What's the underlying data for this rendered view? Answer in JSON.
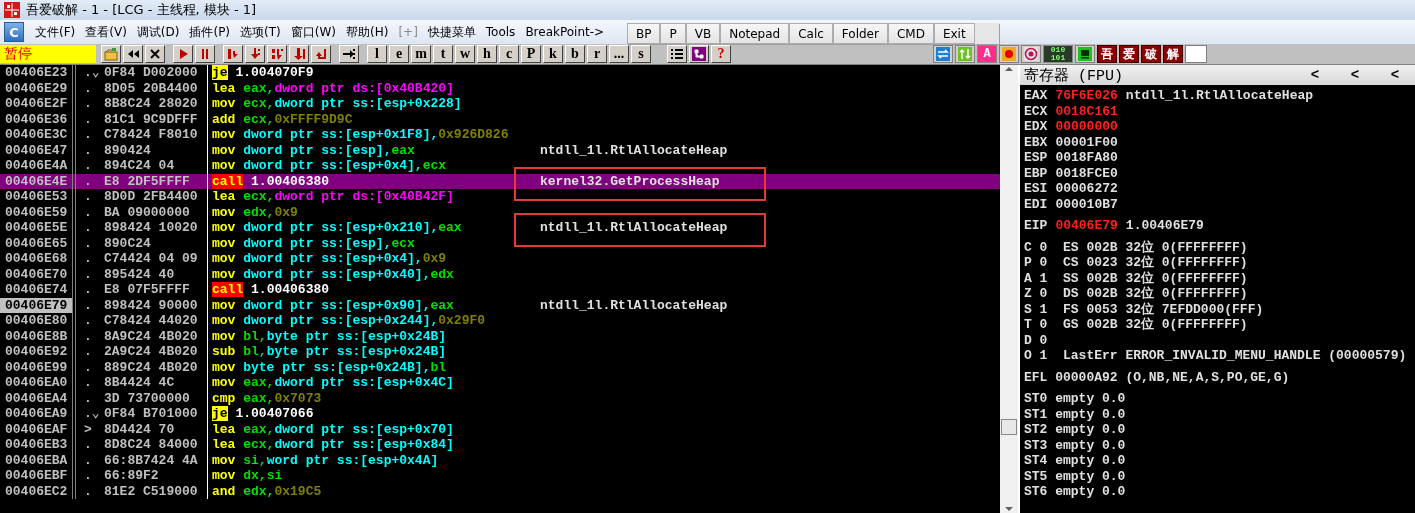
{
  "window": {
    "title": "吾爱破解 - 1 - [LCG - 主线程, 模块 - 1]"
  },
  "menu": {
    "app_label": "C",
    "items": [
      {
        "label": "文件(F)",
        "disabled": false
      },
      {
        "label": "查看(V)",
        "disabled": false
      },
      {
        "label": "调试(D)",
        "disabled": false
      },
      {
        "label": "插件(P)",
        "disabled": false
      },
      {
        "label": "选项(T)",
        "disabled": false
      },
      {
        "label": "窗口(W)",
        "disabled": false
      },
      {
        "label": "帮助(H)",
        "disabled": false
      },
      {
        "label": "[+]",
        "disabled": true
      },
      {
        "label": "快捷菜单",
        "disabled": false
      },
      {
        "label": "Tools",
        "disabled": false
      },
      {
        "label": "BreakPoint->",
        "disabled": false
      }
    ]
  },
  "quick_bar": [
    "BP",
    "P",
    "VB",
    "Notepad",
    "Calc",
    "Folder",
    "CMD",
    "Exit"
  ],
  "toolbar": {
    "status": "暂停",
    "letters": [
      "l",
      "e",
      "m",
      "t",
      "w",
      "h",
      "c",
      "P",
      "k",
      "b",
      "r",
      "...",
      "s"
    ],
    "help": "?",
    "tools": [
      {
        "kind": "swap"
      },
      {
        "kind": "updown"
      },
      {
        "kind": "letter",
        "label": "A"
      },
      {
        "kind": "record"
      },
      {
        "kind": "target"
      },
      {
        "kind": "binary",
        "label": "010 101"
      },
      {
        "kind": "panel"
      },
      {
        "kind": "char",
        "label": "吾"
      },
      {
        "kind": "char",
        "label": "爱"
      },
      {
        "kind": "char",
        "label": "破"
      },
      {
        "kind": "char",
        "label": "解"
      },
      {
        "kind": "blank"
      }
    ]
  },
  "disassembly": {
    "rows": [
      {
        "address": "00406E23",
        "marker": ".⌄",
        "hex": "0F84 D002000",
        "mnemonic": "je",
        "kind": "jump",
        "operands": [
          {
            "text": "1.004070F9",
            "kind": "addr"
          }
        ],
        "selected": false,
        "eip": false
      },
      {
        "address": "00406E29",
        "marker": ".",
        "hex": "8D05 20B4400",
        "mnemonic": "lea",
        "kind": "plain",
        "operands": [
          {
            "text": "eax,",
            "kind": "reg"
          },
          {
            "text": "dword ptr ds:[0x40B420]",
            "kind": "ds"
          }
        ],
        "selected": false,
        "eip": false
      },
      {
        "address": "00406E2F",
        "marker": ".",
        "hex": "8B8C24 28020",
        "mnemonic": "mov",
        "kind": "plain",
        "operands": [
          {
            "text": "ecx,",
            "kind": "reg"
          },
          {
            "text": "dword ptr ss:[esp+0x228]",
            "kind": "mem"
          }
        ],
        "selected": false,
        "eip": false
      },
      {
        "address": "00406E36",
        "marker": ".",
        "hex": "81C1 9C9DFFF",
        "mnemonic": "add",
        "kind": "plain",
        "operands": [
          {
            "text": "ecx,",
            "kind": "reg"
          },
          {
            "text": "0xFFFF9D9C",
            "kind": "imm"
          }
        ],
        "selected": false,
        "eip": false
      },
      {
        "address": "00406E3C",
        "marker": ".",
        "hex": "C78424 F8010",
        "mnemonic": "mov",
        "kind": "plain",
        "operands": [
          {
            "text": "dword ptr ss:[esp+0x1F8],",
            "kind": "mem"
          },
          {
            "text": "0x926D826",
            "kind": "imm"
          }
        ],
        "selected": false,
        "eip": false
      },
      {
        "address": "00406E47",
        "marker": ".",
        "hex": "890424",
        "mnemonic": "mov",
        "kind": "plain",
        "operands": [
          {
            "text": "dword ptr ss:[esp],",
            "kind": "mem"
          },
          {
            "text": "eax",
            "kind": "reg"
          }
        ],
        "selected": false,
        "eip": false,
        "comment": {
          "text": "ntdll_1l.RtlAllocateHeap",
          "boxed": false
        }
      },
      {
        "address": "00406E4A",
        "marker": ".",
        "hex": "894C24 04",
        "mnemonic": "mov",
        "kind": "plain",
        "operands": [
          {
            "text": "dword ptr ss:[esp+0x4],",
            "kind": "mem"
          },
          {
            "text": "ecx",
            "kind": "reg"
          }
        ],
        "selected": false,
        "eip": false
      },
      {
        "address": "00406E4E",
        "marker": ".",
        "hex": "E8 2DF5FFFF",
        "mnemonic": "call",
        "kind": "call",
        "operands": [
          {
            "text": "1.00406380",
            "kind": "addr"
          }
        ],
        "selected": true,
        "eip": false,
        "comment": {
          "text": "kernel32.GetProcessHeap",
          "boxed": true
        }
      },
      {
        "address": "00406E53",
        "marker": ".",
        "hex": "8D0D 2FB4400",
        "mnemonic": "lea",
        "kind": "plain",
        "operands": [
          {
            "text": "ecx,",
            "kind": "reg"
          },
          {
            "text": "dword ptr ds:[0x40B42F]",
            "kind": "ds"
          }
        ],
        "selected": false,
        "eip": false
      },
      {
        "address": "00406E59",
        "marker": ".",
        "hex": "BA 09000000",
        "mnemonic": "mov",
        "kind": "plain",
        "operands": [
          {
            "text": "edx,",
            "kind": "reg"
          },
          {
            "text": "0x9",
            "kind": "imm"
          }
        ],
        "selected": false,
        "eip": false
      },
      {
        "address": "00406E5E",
        "marker": ".",
        "hex": "898424 10020",
        "mnemonic": "mov",
        "kind": "plain",
        "operands": [
          {
            "text": "dword ptr ss:[esp+0x210],",
            "kind": "mem"
          },
          {
            "text": "eax",
            "kind": "reg"
          }
        ],
        "selected": false,
        "eip": false,
        "comment": {
          "text": "ntdll_1l.RtlAllocateHeap",
          "boxed": true
        }
      },
      {
        "address": "00406E65",
        "marker": ".",
        "hex": "890C24",
        "mnemonic": "mov",
        "kind": "plain",
        "operands": [
          {
            "text": "dword ptr ss:[esp],",
            "kind": "mem"
          },
          {
            "text": "ecx",
            "kind": "reg"
          }
        ],
        "selected": false,
        "eip": false
      },
      {
        "address": "00406E68",
        "marker": ".",
        "hex": "C74424 04 09",
        "mnemonic": "mov",
        "kind": "plain",
        "operands": [
          {
            "text": "dword ptr ss:[esp+0x4],",
            "kind": "mem"
          },
          {
            "text": "0x9",
            "kind": "imm"
          }
        ],
        "selected": false,
        "eip": false
      },
      {
        "address": "00406E70",
        "marker": ".",
        "hex": "895424 40",
        "mnemonic": "mov",
        "kind": "plain",
        "operands": [
          {
            "text": "dword ptr ss:[esp+0x40],",
            "kind": "mem"
          },
          {
            "text": "edx",
            "kind": "reg"
          }
        ],
        "selected": false,
        "eip": false
      },
      {
        "address": "00406E74",
        "marker": ".",
        "hex": "E8 07F5FFFF",
        "mnemonic": "call",
        "kind": "call",
        "operands": [
          {
            "text": "1.00406380",
            "kind": "addr"
          }
        ],
        "selected": false,
        "eip": false
      },
      {
        "address": "00406E79",
        "marker": ".",
        "hex": "898424 90000",
        "mnemonic": "mov",
        "kind": "plain",
        "operands": [
          {
            "text": "dword ptr ss:[esp+0x90],",
            "kind": "mem"
          },
          {
            "text": "eax",
            "kind": "reg"
          }
        ],
        "selected": false,
        "eip": true,
        "comment": {
          "text": "ntdll_1l.RtlAllocateHeap",
          "boxed": false
        }
      },
      {
        "address": "00406E80",
        "marker": ".",
        "hex": "C78424 44020",
        "mnemonic": "mov",
        "kind": "plain",
        "operands": [
          {
            "text": "dword ptr ss:[esp+0x244],",
            "kind": "mem"
          },
          {
            "text": "0x29F0",
            "kind": "imm"
          }
        ],
        "selected": false,
        "eip": false
      },
      {
        "address": "00406E8B",
        "marker": ".",
        "hex": "8A9C24 4B020",
        "mnemonic": "mov",
        "kind": "plain",
        "operands": [
          {
            "text": "bl,",
            "kind": "reg"
          },
          {
            "text": "byte ptr ss:[esp+0x24B]",
            "kind": "mem"
          }
        ],
        "selected": false,
        "eip": false
      },
      {
        "address": "00406E92",
        "marker": ".",
        "hex": "2A9C24 4B020",
        "mnemonic": "sub",
        "kind": "plain",
        "operands": [
          {
            "text": "bl,",
            "kind": "reg"
          },
          {
            "text": "byte ptr ss:[esp+0x24B]",
            "kind": "mem"
          }
        ],
        "selected": false,
        "eip": false
      },
      {
        "address": "00406E99",
        "marker": ".",
        "hex": "889C24 4B020",
        "mnemonic": "mov",
        "kind": "plain",
        "operands": [
          {
            "text": "byte ptr ss:[esp+0x24B],",
            "kind": "mem"
          },
          {
            "text": "bl",
            "kind": "reg"
          }
        ],
        "selected": false,
        "eip": false
      },
      {
        "address": "00406EA0",
        "marker": ".",
        "hex": "8B4424 4C",
        "mnemonic": "mov",
        "kind": "plain",
        "operands": [
          {
            "text": "eax,",
            "kind": "reg"
          },
          {
            "text": "dword ptr ss:[esp+0x4C]",
            "kind": "mem"
          }
        ],
        "selected": false,
        "eip": false
      },
      {
        "address": "00406EA4",
        "marker": ".",
        "hex": "3D 73700000",
        "mnemonic": "cmp",
        "kind": "plain",
        "operands": [
          {
            "text": "eax,",
            "kind": "reg"
          },
          {
            "text": "0x7073",
            "kind": "imm"
          }
        ],
        "selected": false,
        "eip": false
      },
      {
        "address": "00406EA9",
        "marker": ".⌄",
        "hex": "0F84 B701000",
        "mnemonic": "je",
        "kind": "jump",
        "operands": [
          {
            "text": "1.00407066",
            "kind": "addr"
          }
        ],
        "selected": false,
        "eip": false
      },
      {
        "address": "00406EAF",
        "marker": ">",
        "hex": "8D4424 70",
        "mnemonic": "lea",
        "kind": "plain",
        "operands": [
          {
            "text": "eax,",
            "kind": "reg"
          },
          {
            "text": "dword ptr ss:[esp+0x70]",
            "kind": "mem"
          }
        ],
        "selected": false,
        "eip": false
      },
      {
        "address": "00406EB3",
        "marker": ".",
        "hex": "8D8C24 84000",
        "mnemonic": "lea",
        "kind": "plain",
        "operands": [
          {
            "text": "ecx,",
            "kind": "reg"
          },
          {
            "text": "dword ptr ss:[esp+0x84]",
            "kind": "mem"
          }
        ],
        "selected": false,
        "eip": false
      },
      {
        "address": "00406EBA",
        "marker": ".",
        "hex": "66:8B7424 4A",
        "mnemonic": "mov",
        "kind": "plain",
        "operands": [
          {
            "text": "si,",
            "kind": "reg"
          },
          {
            "text": "word ptr ss:[esp+0x4A]",
            "kind": "mem"
          }
        ],
        "selected": false,
        "eip": false
      },
      {
        "address": "00406EBF",
        "marker": ".",
        "hex": "66:89F2",
        "mnemonic": "mov",
        "kind": "plain",
        "operands": [
          {
            "text": "dx,",
            "kind": "reg"
          },
          {
            "text": "si",
            "kind": "reg"
          }
        ],
        "selected": false,
        "eip": false
      },
      {
        "address": "00406EC2",
        "marker": ".",
        "hex": "81E2 C519000",
        "mnemonic": "and",
        "kind": "plain",
        "operands": [
          {
            "text": "edx,",
            "kind": "reg"
          },
          {
            "text": "0x19C5",
            "kind": "imm"
          }
        ],
        "selected": false,
        "eip": false
      }
    ]
  },
  "registers": {
    "title": "寄存器 (FPU)",
    "buttons": [
      "<",
      "<",
      "<"
    ],
    "general": [
      {
        "name": "EAX",
        "value": "76F6E026",
        "changed": true,
        "comment": "ntdll_1l.RtlAllocateHeap"
      },
      {
        "name": "ECX",
        "value": "0018C161",
        "changed": true
      },
      {
        "name": "EDX",
        "value": "00000000",
        "changed": true
      },
      {
        "name": "EBX",
        "value": "00001F00",
        "changed": false
      },
      {
        "name": "ESP",
        "value": "0018FA80",
        "changed": false
      },
      {
        "name": "EBP",
        "value": "0018FCE0",
        "changed": false
      },
      {
        "name": "ESI",
        "value": "00006272",
        "changed": false
      },
      {
        "name": "EDI",
        "value": "000010B7",
        "changed": false
      }
    ],
    "eip": {
      "name": "EIP",
      "value": "00406E79",
      "changed": true,
      "comment": "1.00406E79"
    },
    "flags": [
      "C 0  ES 002B 32位 0(FFFFFFFF)",
      "P 0  CS 0023 32位 0(FFFFFFFF)",
      "A 1  SS 002B 32位 0(FFFFFFFF)",
      "Z 0  DS 002B 32位 0(FFFFFFFF)",
      "S 1  FS 0053 32位 7EFDD000(FFF)",
      "T 0  GS 002B 32位 0(FFFFFFFF)",
      "D 0",
      "O 1  LastErr ERROR_INVALID_MENU_HANDLE (00000579)"
    ],
    "efl": "EFL 00000A92 (O,NB,NE,A,S,PO,GE,G)",
    "fpu": [
      "ST0 empty 0.0",
      "ST1 empty 0.0",
      "ST2 empty 0.0",
      "ST3 empty 0.0",
      "ST4 empty 0.0",
      "ST5 empty 0.0",
      "ST6 empty 0.0"
    ]
  }
}
